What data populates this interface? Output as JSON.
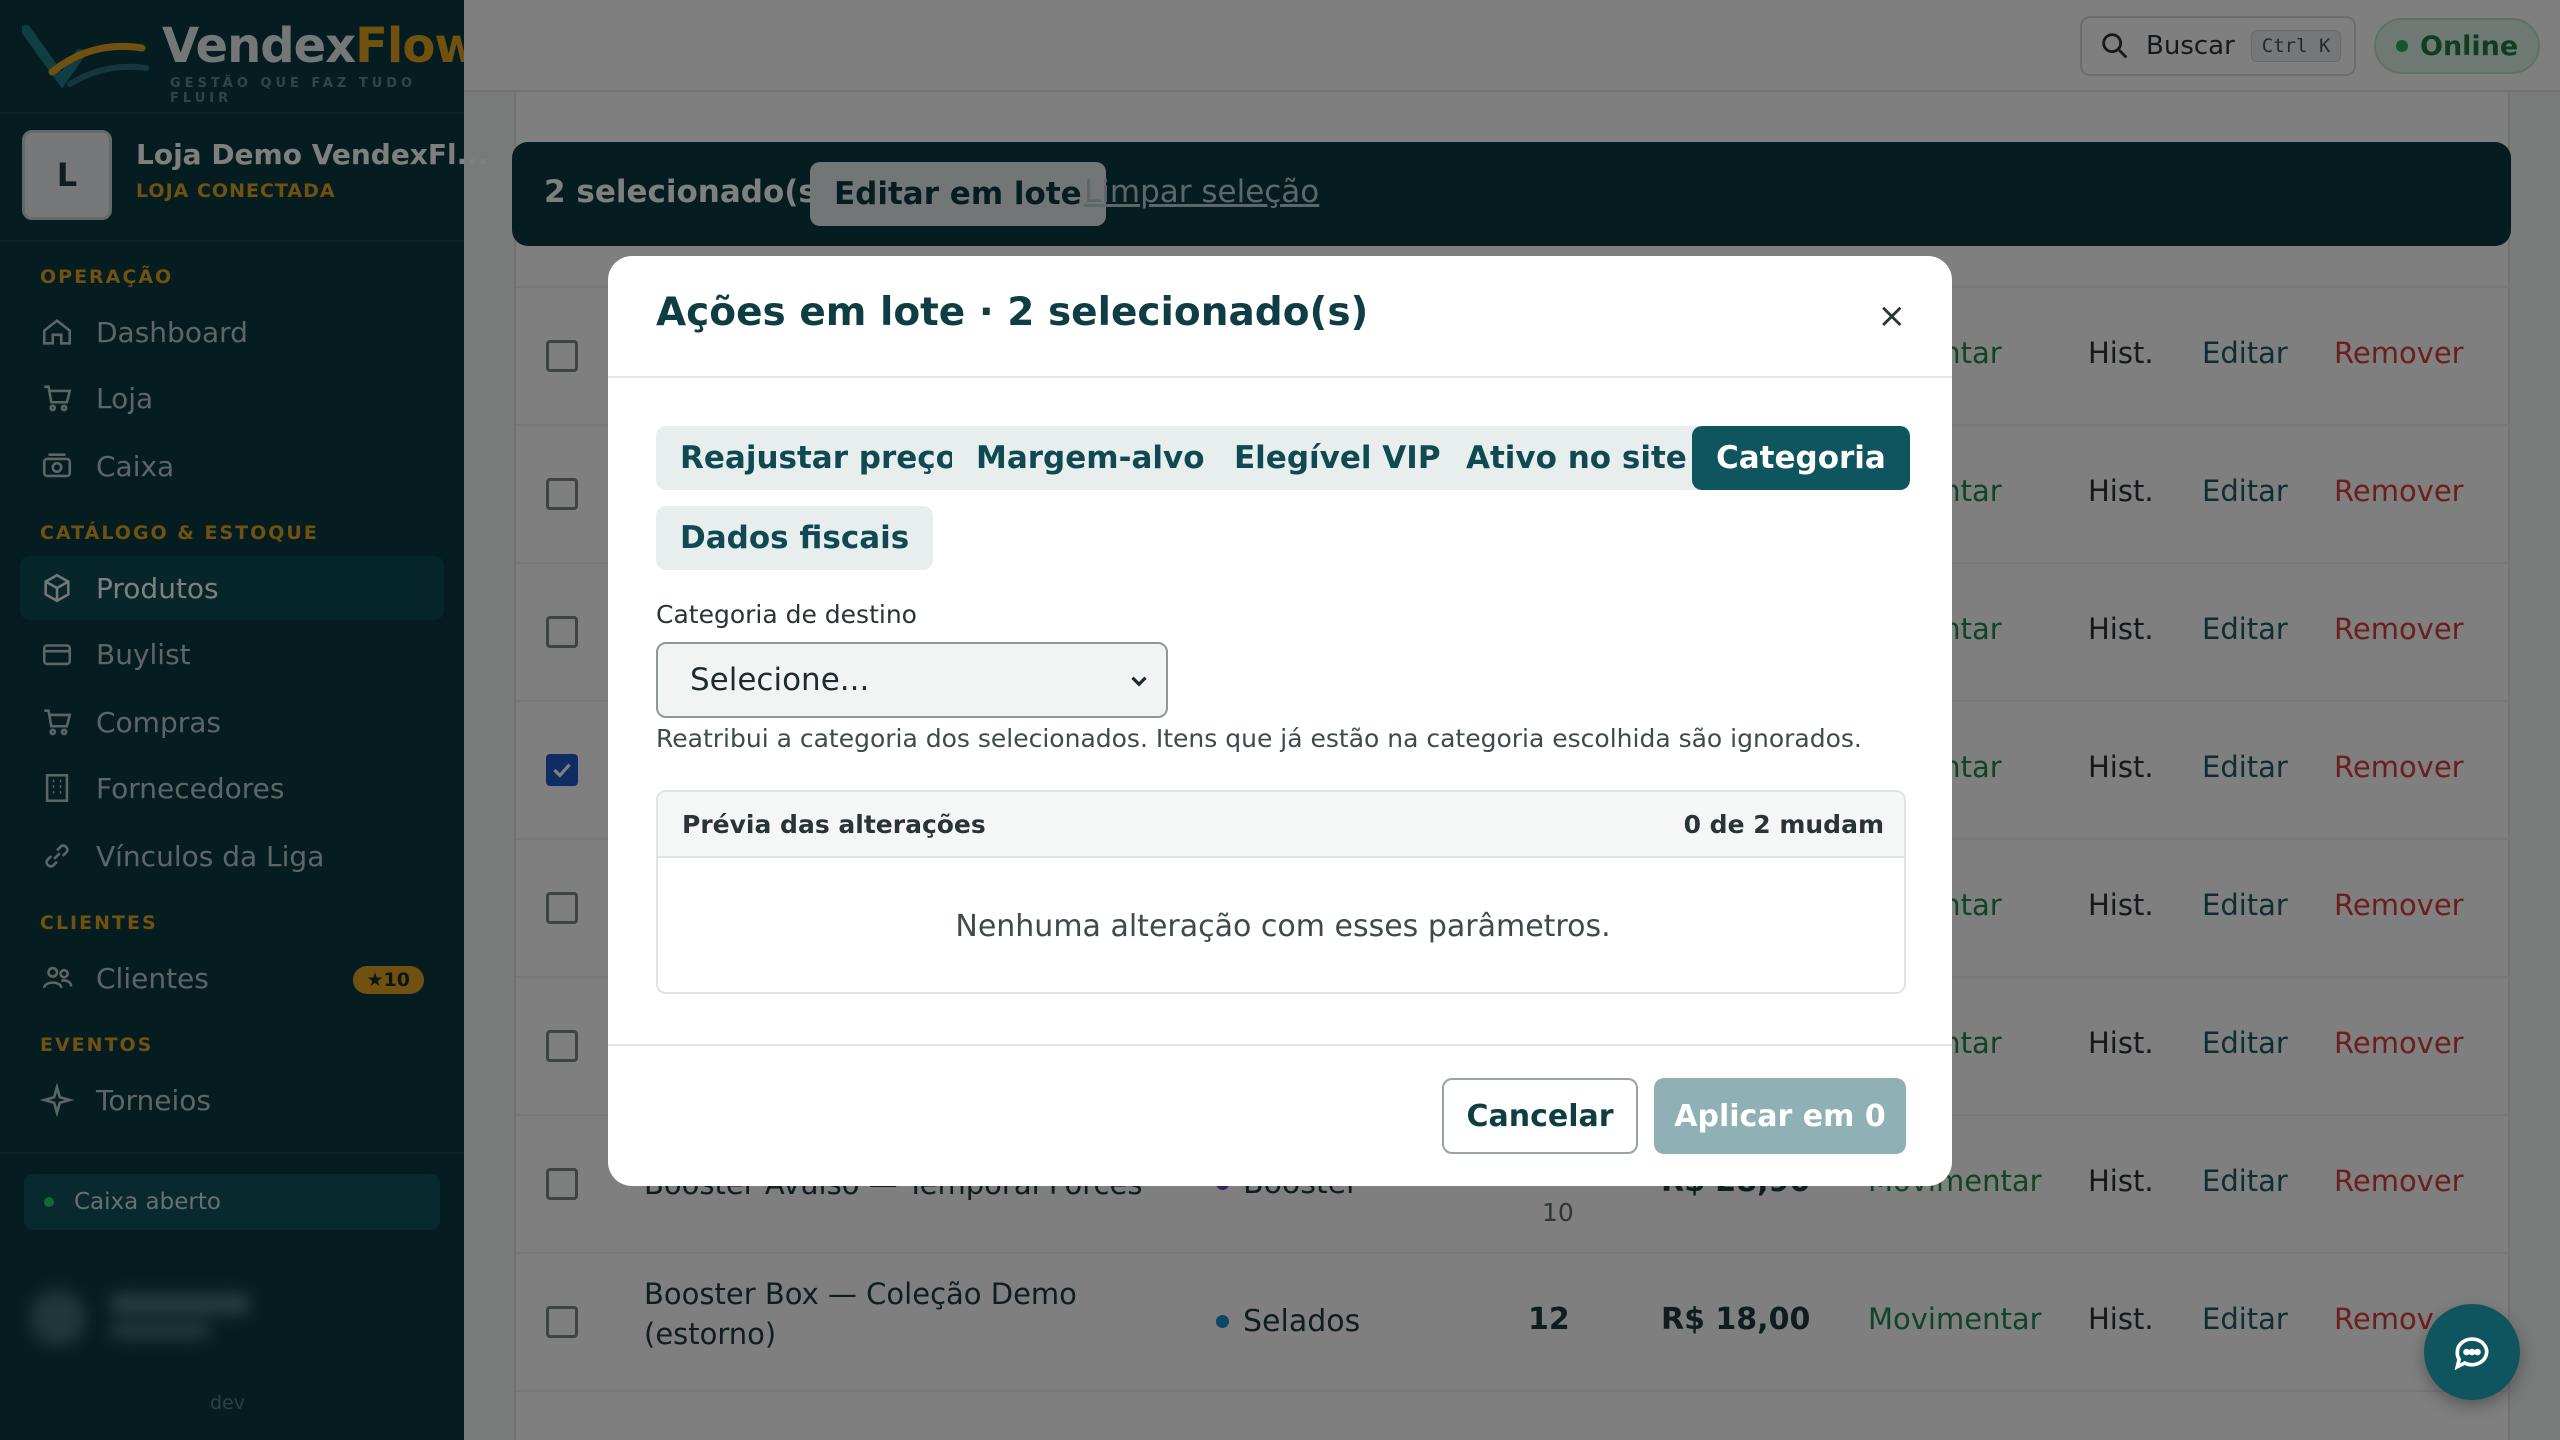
{
  "brand": {
    "name_main": "Vendex",
    "name_accent": "Flow",
    "tagline": "GESTÃO QUE FAZ TUDO FLUIR"
  },
  "store": {
    "initial": "L",
    "name": "Loja Demo VendexFl...",
    "status": "LOJA CONECTADA"
  },
  "sidebar": {
    "sections": [
      "OPERAÇÃO",
      "CATÁLOGO & ESTOQUE",
      "CLIENTES",
      "EVENTOS"
    ],
    "items": [
      {
        "label": "Dashboard",
        "icon": "home-icon"
      },
      {
        "label": "Loja",
        "icon": "cart-icon"
      },
      {
        "label": "Caixa",
        "icon": "register-icon"
      },
      {
        "label": "Produtos",
        "icon": "box-icon",
        "active": true
      },
      {
        "label": "Buylist",
        "icon": "card-icon"
      },
      {
        "label": "Compras",
        "icon": "cart-icon"
      },
      {
        "label": "Fornecedores",
        "icon": "building-icon"
      },
      {
        "label": "Vínculos da Liga",
        "icon": "link-icon"
      },
      {
        "label": "Clientes",
        "icon": "users-icon",
        "badge": "★10"
      },
      {
        "label": "Torneios",
        "icon": "sparkle-icon"
      }
    ],
    "cash_status": "Caixa aberto",
    "version": "dev"
  },
  "topbar": {
    "search_label": "Buscar",
    "shortcut": "Ctrl K",
    "status": "Online"
  },
  "bulk_bar": {
    "count": "2 selecionado(s)",
    "edit_label": "Editar em lote",
    "clear_label": "Limpar seleção"
  },
  "table": {
    "actions": {
      "move": "Movimentar",
      "move_partial": "nentar",
      "history": "Hist.",
      "edit": "Editar",
      "remove": "Remover",
      "remove_partial": "Remov"
    },
    "rows": [
      {
        "checked": false
      },
      {
        "checked": false
      },
      {
        "checked": false
      },
      {
        "checked": true
      },
      {
        "checked": false
      },
      {
        "checked": false
      },
      {
        "checked": false,
        "name": "Booster Avulso — Temporal Forces",
        "category": "Booster",
        "qty_sub": "10",
        "price": "R$ 28,90"
      },
      {
        "checked": false,
        "name": "Booster Box — Coleção Demo (estorno)",
        "category": "Selados",
        "qty": "12",
        "price": "R$ 18,00"
      }
    ]
  },
  "modal": {
    "title": "Ações em lote · 2 selecionado(s)",
    "close": "×",
    "tabs": [
      "Reajustar preço",
      "Margem-alvo",
      "Elegível VIP",
      "Ativo no site",
      "Categoria",
      "Dados fiscais"
    ],
    "active_tab": "Categoria",
    "field_label": "Categoria de destino",
    "select_value": "Selecione...",
    "help": "Reatribui a categoria dos selecionados. Itens que já estão na categoria escolhida são ignorados.",
    "preview_title": "Prévia das alterações",
    "preview_count": "0 de 2 mudam",
    "preview_empty": "Nenhuma alteração com esses parâmetros.",
    "cancel": "Cancelar",
    "apply": "Aplicar em 0"
  },
  "colors": {
    "sidebar": "#0a3b42",
    "accent": "#e3a321",
    "primary": "#0f5560",
    "danger": "#d93a3a",
    "success": "#1e8a4a"
  }
}
